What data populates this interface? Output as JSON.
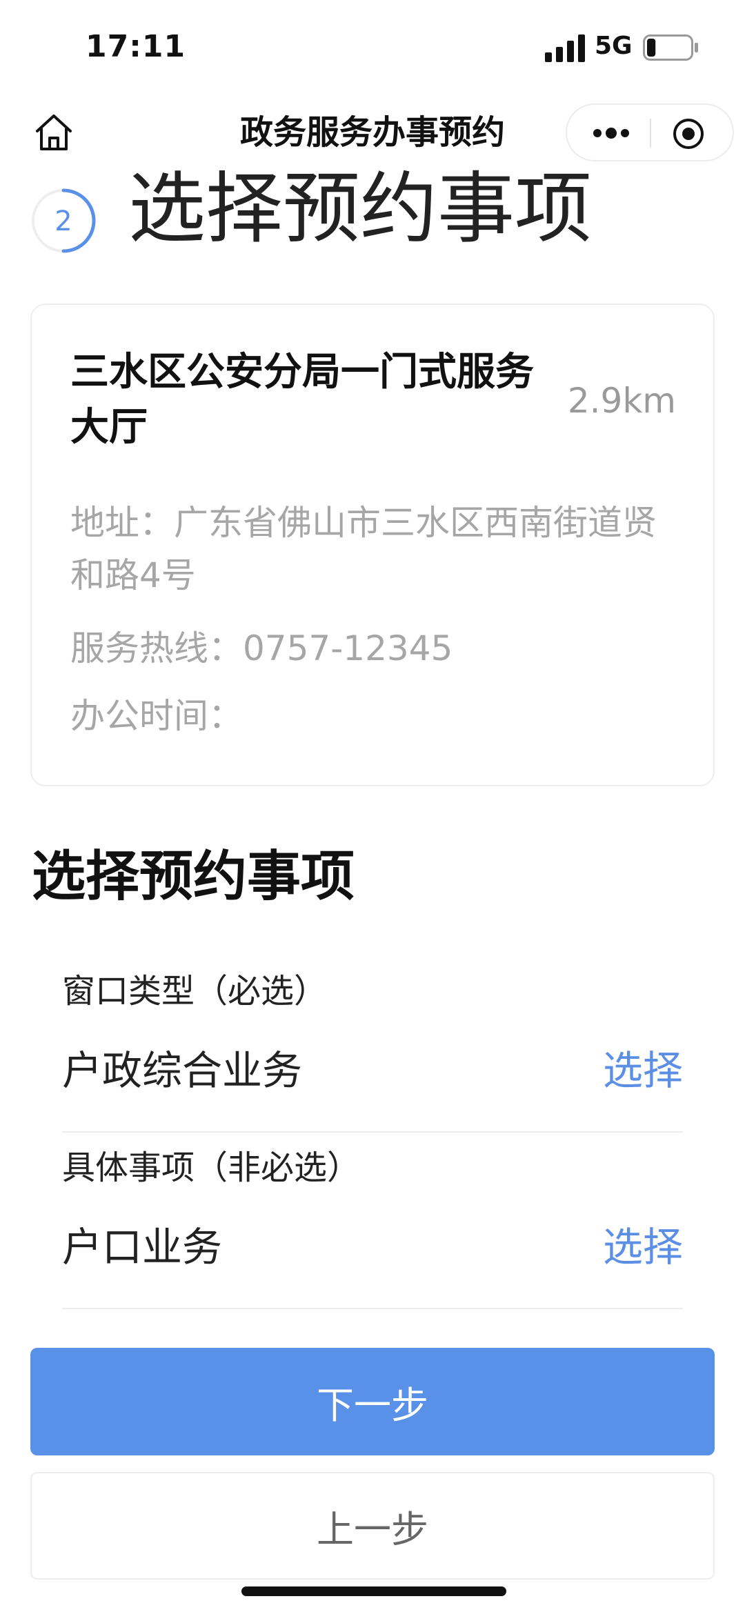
{
  "status_bar": {
    "time": "17:11",
    "network": "5G",
    "signal_icon": "signal-bars-icon",
    "battery_icon": "battery-low-icon",
    "battery_level": 0.2
  },
  "nav": {
    "title": "政务服务办事预约",
    "home_icon": "home-icon",
    "more_icon": "more-dots-icon",
    "target_icon": "target-icon"
  },
  "step": {
    "number": "2",
    "title": "选择预约事项",
    "progress": 0.5
  },
  "hall": {
    "name": "三水区公安分局一门式服务大厅",
    "distance": "2.9km",
    "address": "地址：广东省佛山市三水区西南街道贤和路4号",
    "hotline": "服务热线：0757-12345",
    "office_hours": "办公时间："
  },
  "section": {
    "title": "选择预约事项"
  },
  "fields": {
    "window_type": {
      "label": "窗口类型（必选）",
      "value": "户政综合业务",
      "action": "选择"
    },
    "specific_item": {
      "label": "具体事项（非必选）",
      "value": "户口业务",
      "action": "选择"
    }
  },
  "buttons": {
    "next": "下一步",
    "prev": "上一步"
  },
  "colors": {
    "accent": "#5a91e8",
    "link": "#5b8fe5",
    "muted_text": "#a6a6a6"
  }
}
